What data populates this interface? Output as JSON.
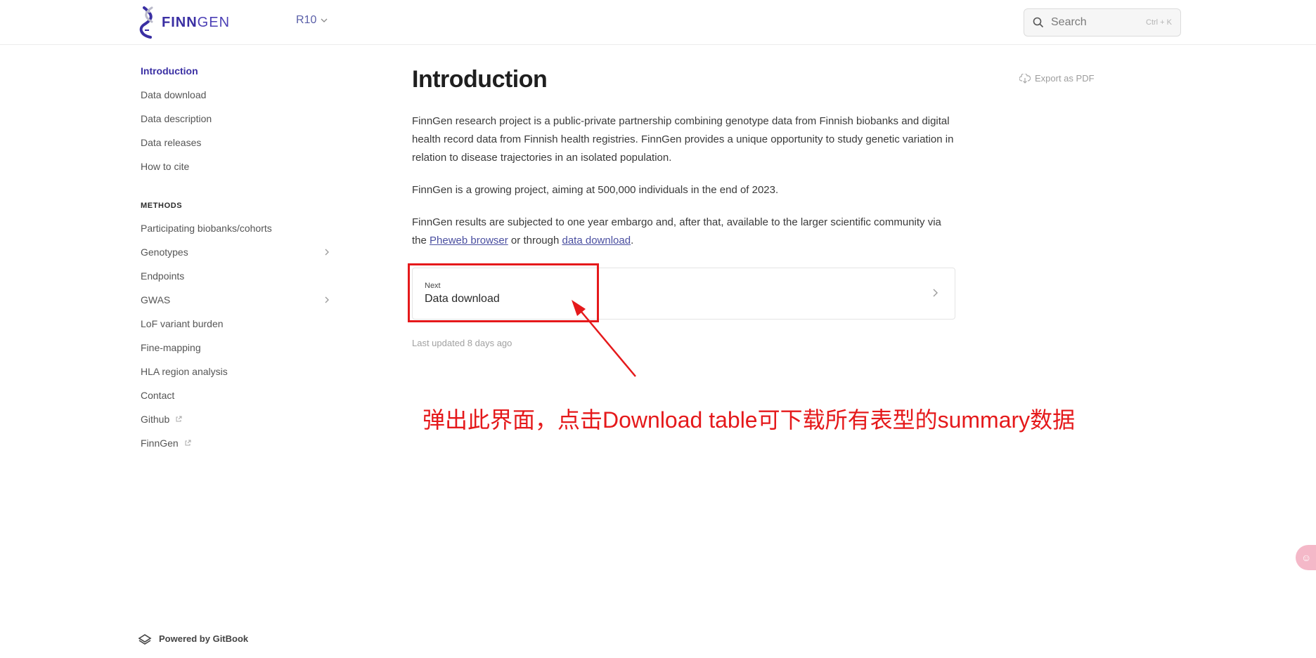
{
  "header": {
    "logo_text_bold": "FINN",
    "logo_text_light": "GEN",
    "version": "R10",
    "search": {
      "label": "Search",
      "shortcut": "Ctrl + K"
    }
  },
  "sidebar": {
    "items": [
      {
        "label": "Introduction",
        "active": true
      },
      {
        "label": "Data download"
      },
      {
        "label": "Data description"
      },
      {
        "label": "Data releases"
      },
      {
        "label": "How to cite"
      }
    ],
    "section_title": "METHODS",
    "methods": [
      {
        "label": "Participating biobanks/cohorts"
      },
      {
        "label": "Genotypes",
        "expandable": true
      },
      {
        "label": "Endpoints"
      },
      {
        "label": "GWAS",
        "expandable": true
      },
      {
        "label": "LoF variant burden"
      },
      {
        "label": "Fine-mapping"
      },
      {
        "label": "HLA region analysis"
      },
      {
        "label": "Contact"
      },
      {
        "label": "Github",
        "external": true
      },
      {
        "label": "FinnGen",
        "external": true
      }
    ],
    "powered_by": "Powered by GitBook"
  },
  "main": {
    "title": "Introduction",
    "export_label": "Export as PDF",
    "paragraph1": "FinnGen research project is a public-private partnership combining genotype data from Finnish biobanks and digital health record data from Finnish health registries. FinnGen provides a unique opportunity to study genetic variation in relation to disease trajectories in an isolated population.",
    "paragraph2": "FinnGen is a growing project, aiming at 500,000 individuals in the end of 2023.",
    "paragraph3": {
      "before": "FinnGen results are subjected to one year embargo and, after that, available to the larger scientific community via the ",
      "link1": "Pheweb browser",
      "middle": " or through ",
      "link2": "data download",
      "after": "."
    },
    "next": {
      "sub": "Next",
      "title": "Data download"
    },
    "last_updated": "Last updated 8 days ago"
  },
  "annotation": {
    "text": "弹出此界面，点击Download table可下载所有表型的summary数据",
    "color": "#e5191b"
  },
  "colors": {
    "brand": "#3a2fa3",
    "accent_red": "#e5191b"
  }
}
